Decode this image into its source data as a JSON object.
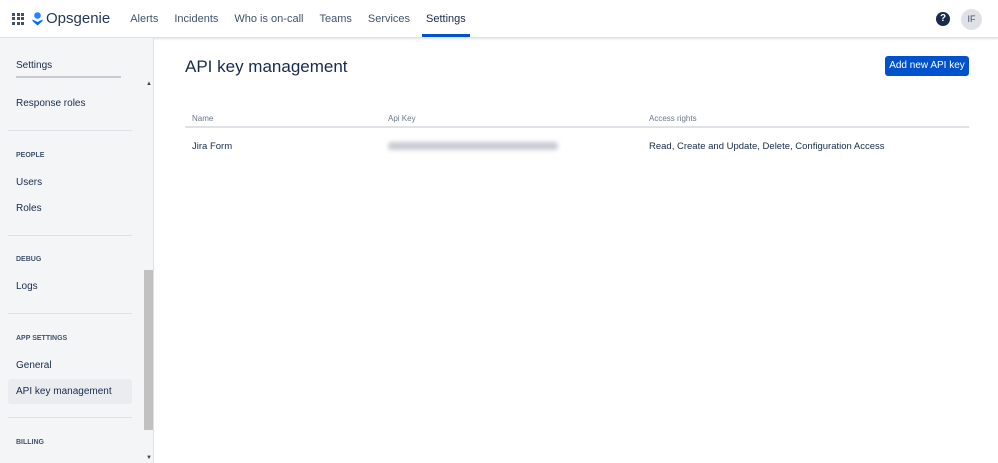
{
  "header": {
    "brand": "Opsgenie",
    "nav": [
      "Alerts",
      "Incidents",
      "Who is on-call",
      "Teams",
      "Services",
      "Settings"
    ],
    "active": "Settings",
    "help": "?",
    "avatar": "IF"
  },
  "sidebar": {
    "top_label": "Settings",
    "items": {
      "response_roles": "Response roles",
      "people": "PEOPLE",
      "users": "Users",
      "roles": "Roles",
      "debug": "DEBUG",
      "logs": "Logs",
      "app_settings": "APP SETTINGS",
      "general": "General",
      "api_key": "API key management",
      "billing": "BILLING"
    }
  },
  "main": {
    "title": "API key management",
    "add_button": "Add new API key",
    "columns": [
      "Name",
      "Api Key",
      "Access rights"
    ],
    "rows": [
      {
        "name": "Jira Form",
        "access": "Read, Create and Update, Delete, Configuration Access"
      }
    ]
  },
  "colors": {
    "accent": "#0052cc"
  }
}
